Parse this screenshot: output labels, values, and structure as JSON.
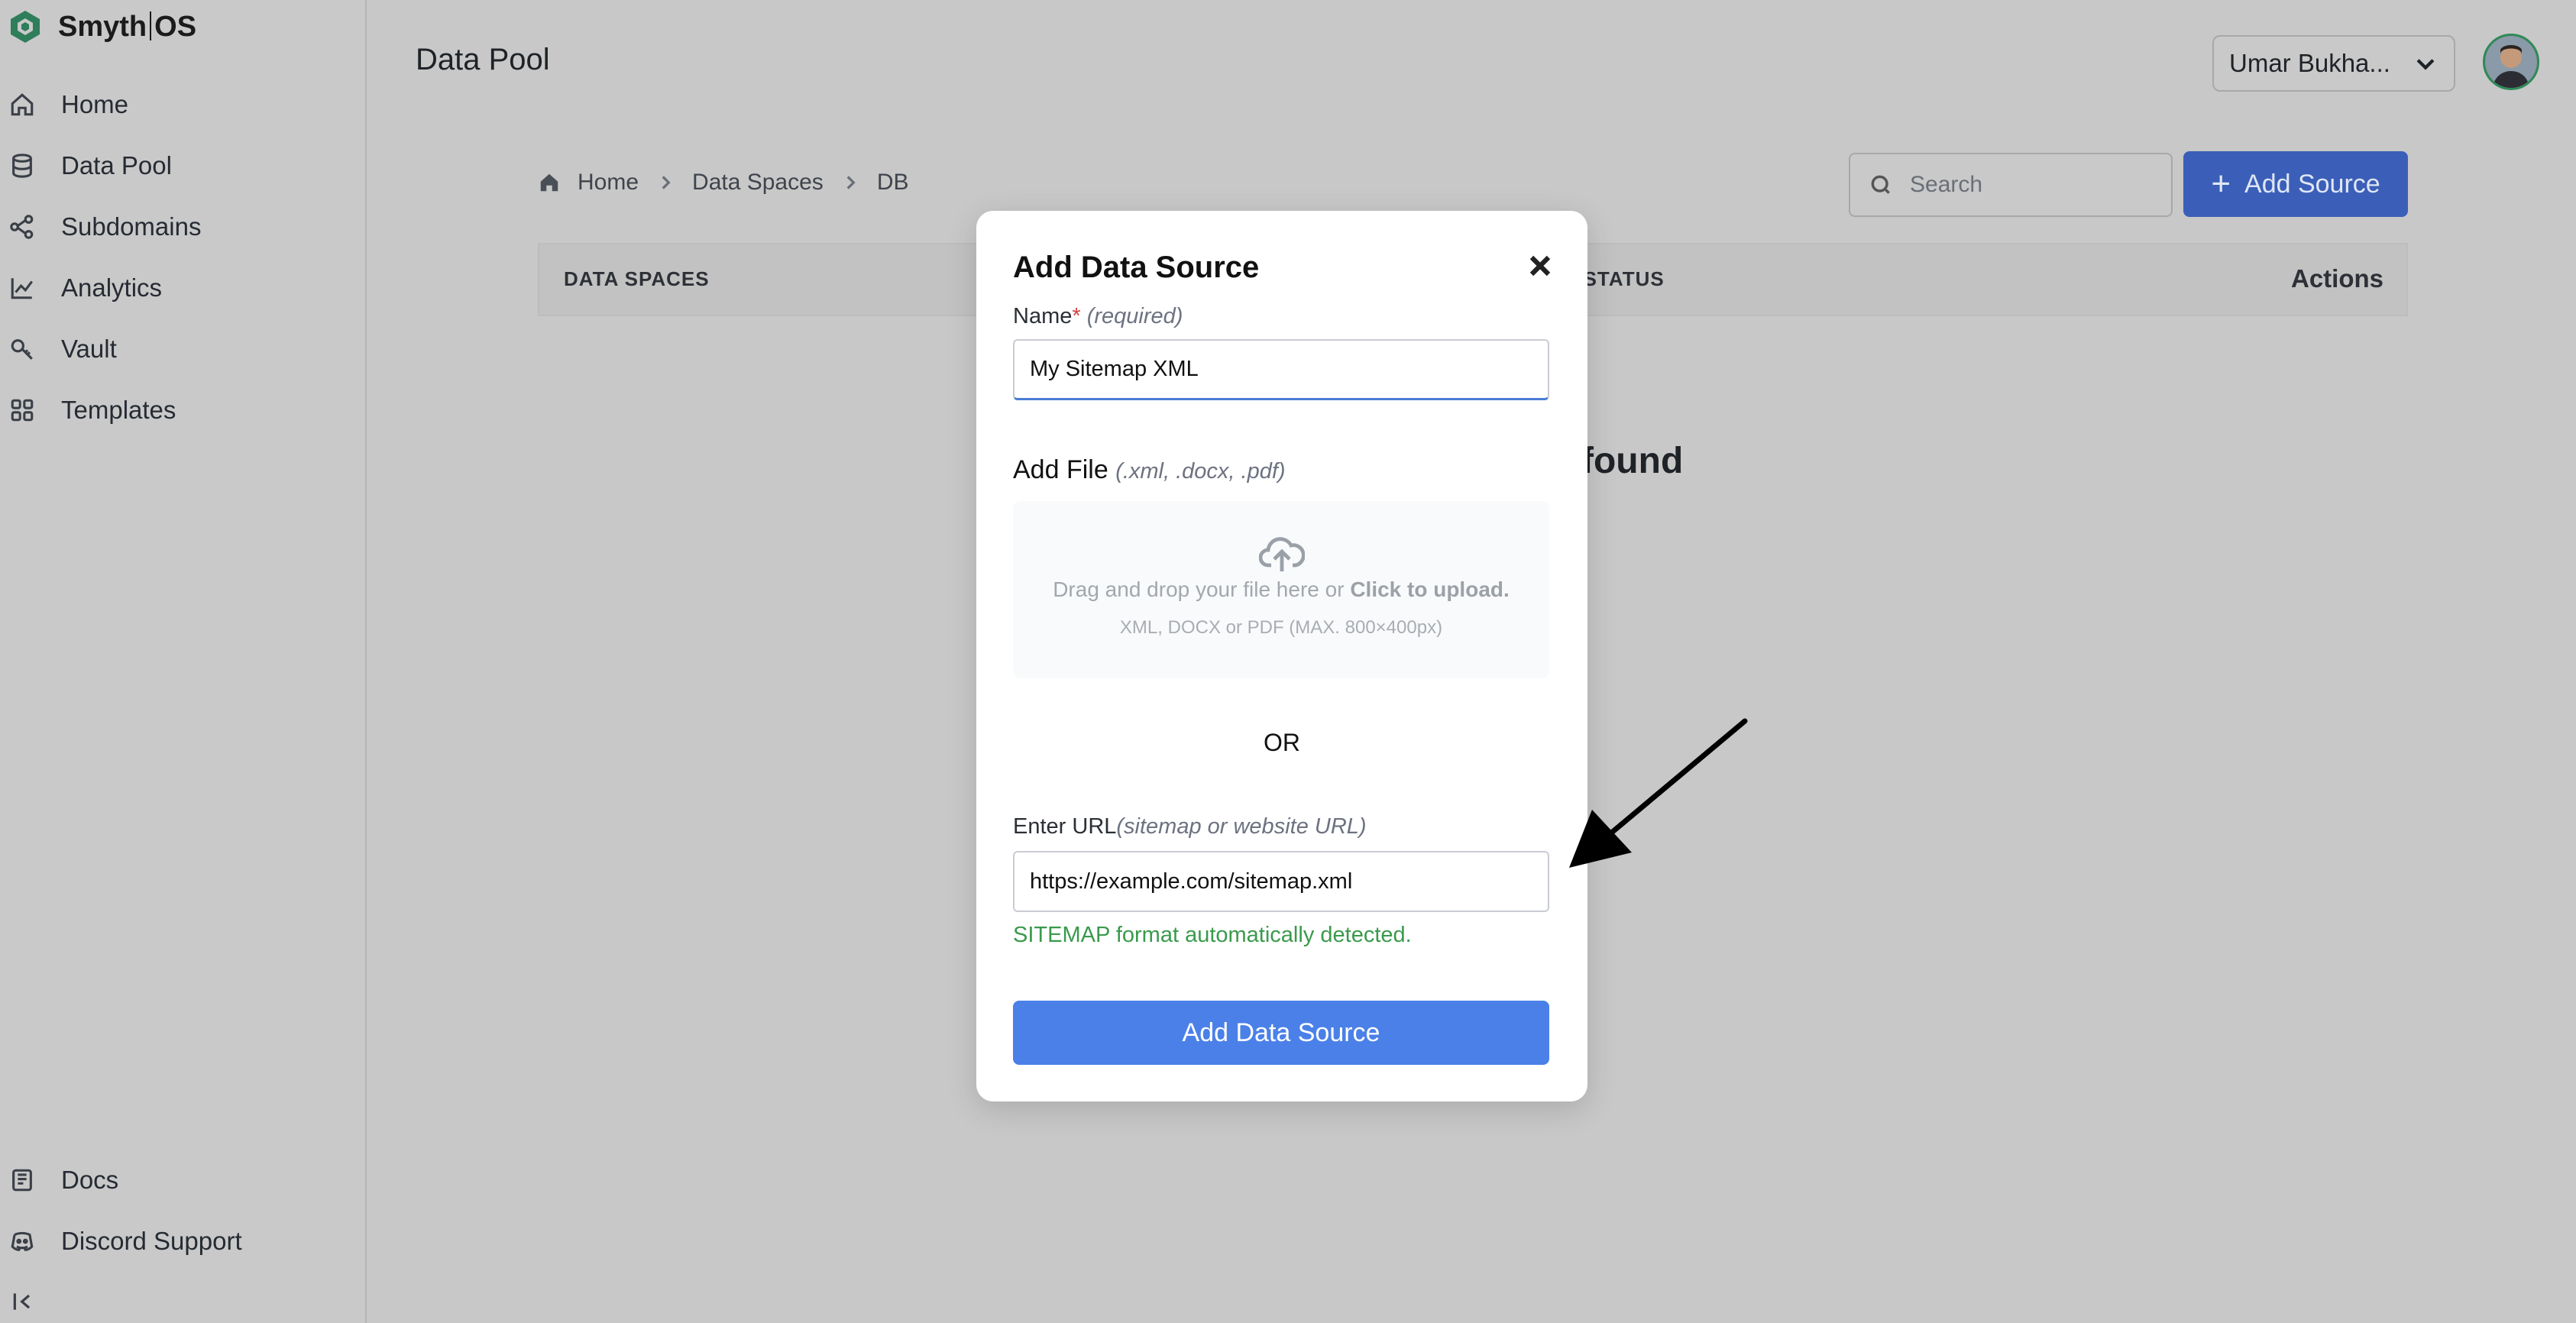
{
  "app": {
    "logo_left": "Smyth",
    "logo_right": "OS"
  },
  "sidebar": {
    "items": [
      {
        "label": "Home",
        "icon": "home-icon"
      },
      {
        "label": "Data Pool",
        "icon": "database-icon"
      },
      {
        "label": "Subdomains",
        "icon": "subdomains-icon"
      },
      {
        "label": "Analytics",
        "icon": "chart-line-icon"
      },
      {
        "label": "Vault",
        "icon": "key-icon"
      },
      {
        "label": "Templates",
        "icon": "grid-icon"
      }
    ],
    "bottom_items": [
      {
        "label": "Docs",
        "icon": "book-icon"
      },
      {
        "label": "Discord Support",
        "icon": "discord-icon"
      }
    ]
  },
  "header": {
    "title": "Data Pool",
    "user_name": "Umar Bukha..."
  },
  "breadcrumb": [
    "Home",
    "Data Spaces",
    "DB"
  ],
  "toolbar": {
    "search_placeholder": "Search",
    "add_source_label": "Add Source"
  },
  "table": {
    "headers": {
      "data_spaces": "DATA SPACES",
      "status": "S STATUS",
      "actions": "Actions"
    },
    "empty_text_partial": "found"
  },
  "modal": {
    "title": "Add Data Source",
    "name_label": "Name",
    "name_required_mark": "*",
    "name_hint": "(required)",
    "name_value": "My Sitemap XML",
    "file_label": "Add File",
    "file_hint": "(.xml, .docx, .pdf)",
    "drop_text": "Drag and drop your file here or",
    "drop_link": "Click to upload.",
    "drop_sub": "XML, DOCX or PDF (MAX. 800×400px)",
    "or_text": "OR",
    "url_label": "Enter URL",
    "url_hint": "(sitemap or website URL)",
    "url_value": "https://example.com/sitemap.xml",
    "detected_text": "SITEMAP format automatically detected.",
    "submit_label": "Add Data Source"
  },
  "colors": {
    "primary": "#4a80e8",
    "success": "#3a9a4c",
    "required": "#d14343",
    "overlay_bg": "#c8c8c8"
  }
}
